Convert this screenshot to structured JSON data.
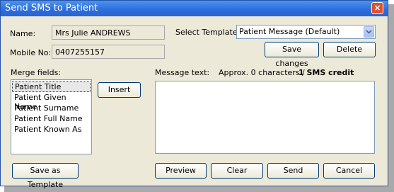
{
  "window": {
    "title": "Send SMS to Patient",
    "close_symbol": "×"
  },
  "name": {
    "label": "Name:",
    "value": "Mrs Julie ANDREWS"
  },
  "mobile": {
    "label": "Mobile No:",
    "value": "0407255157"
  },
  "template": {
    "label": "Select Template:",
    "selected": "Patient Message (Default)"
  },
  "buttons": {
    "save_changes": "Save changes",
    "delete": "Delete",
    "insert": "Insert",
    "save_as_template": "Save as Template",
    "preview": "Preview",
    "clear": "Clear",
    "send": "Send",
    "cancel": "Cancel"
  },
  "merge_fields": {
    "label": "Merge fields:",
    "items": [
      "Patient Title",
      "Patient Given Name",
      "Patient Surname",
      "Patient Full Name",
      "Patient Known As"
    ]
  },
  "message": {
    "label": "Message text:",
    "count": "Approx. 0 characters /",
    "credit": "1 SMS credit",
    "value": ""
  }
}
